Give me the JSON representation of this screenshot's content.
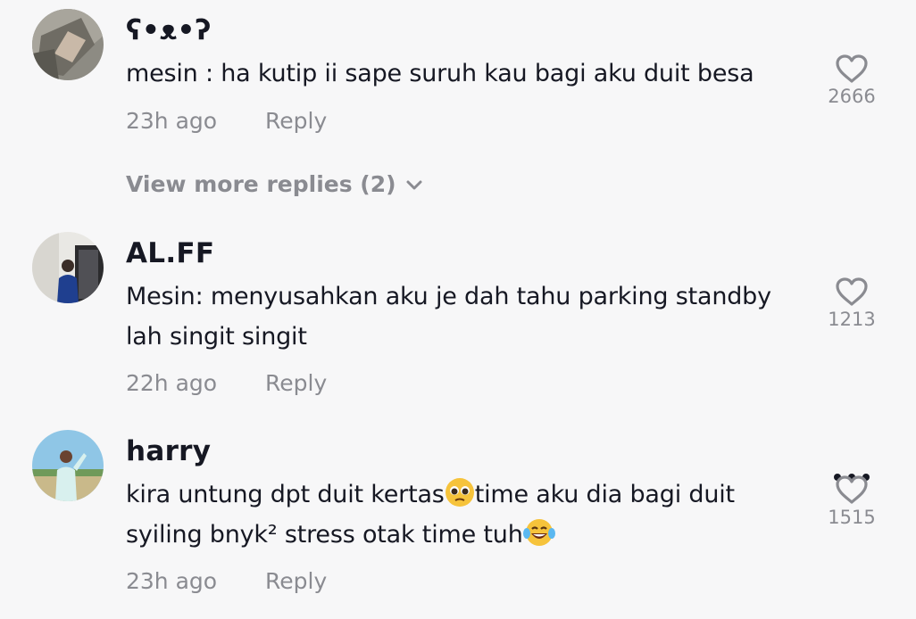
{
  "comments": [
    {
      "username": "ʕ•ᴥ•ʔ",
      "text": "mesin : ha kutip ii sape suruh kau bagi aku duit besa",
      "time": "23h ago",
      "reply_label": "Reply",
      "likes": "2666"
    },
    {
      "username": "AL.FF",
      "text": "Mesin: menyusahkan aku je dah tahu parking standby lah singit singit",
      "time": "22h ago",
      "reply_label": "Reply",
      "likes": "1213"
    },
    {
      "username": "harry",
      "text_parts": [
        "kira untung dpt duit kertas",
        "time aku dia bagi duit syiling bnyk² stress otak time tuh"
      ],
      "emojis": [
        "pleading-face-emoji",
        "tears-of-joy-emoji"
      ],
      "time": "23h ago",
      "reply_label": "Reply",
      "likes": "1515"
    }
  ],
  "view_more": {
    "label": "View more replies (2)"
  },
  "icons": {
    "like": "heart-outline-icon",
    "more": "more-options-icon",
    "expand": "chevron-down-icon"
  },
  "colors": {
    "background": "#f7f7f8",
    "primary_text": "#161823",
    "secondary_text": "#8a8b91"
  }
}
